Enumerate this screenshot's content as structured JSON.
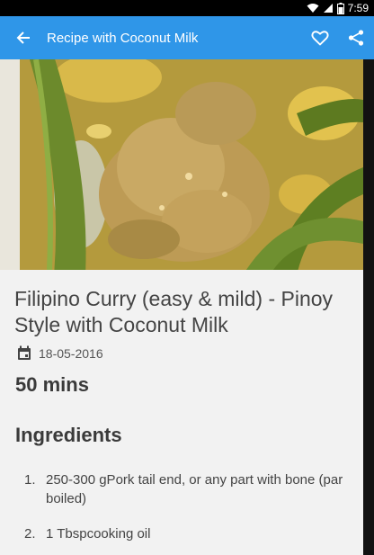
{
  "status_bar": {
    "time": "7:59"
  },
  "app_bar": {
    "title": "Recipe with Coconut Milk",
    "back_icon": "arrow-back-icon",
    "favorite_icon": "heart-outline-icon",
    "share_icon": "share-icon"
  },
  "recipe": {
    "title": "Filipino Curry (easy & mild) - Pinoy Style with Coconut Milk",
    "date_icon": "calendar-icon",
    "date": "18-05-2016",
    "duration": "50 mins",
    "ingredients_heading": "Ingredients",
    "ingredients": [
      {
        "number": "1.",
        "text": "250-300 gPork tail end, or any part with bone (par boiled)"
      },
      {
        "number": "2.",
        "text": "1 Tbspcooking oil"
      }
    ]
  },
  "colors": {
    "app_bar": "#2f96e8",
    "status_bar": "#000000",
    "background": "#f2f2f2"
  }
}
